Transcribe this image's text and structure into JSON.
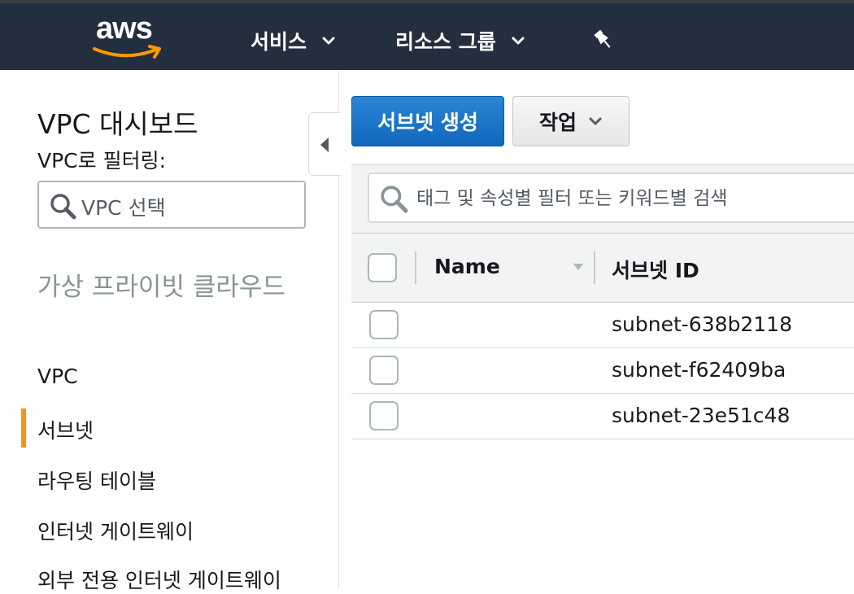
{
  "topbar": {
    "logo_text": "aws",
    "services_label": "서비스",
    "resource_groups_label": "리소스 그룹",
    "colors": {
      "background": "#232f3e",
      "smile": "#ff9900"
    },
    "icons": [
      "chevron-down-icon",
      "pin-icon"
    ]
  },
  "sidebar": {
    "title": "VPC 대시보드",
    "filter_label": "VPC로 필터링:",
    "vpc_select_placeholder": "VPC 선택",
    "section_heading": "가상 프라이빗 클라우드",
    "items": [
      {
        "label": "VPC",
        "active": false
      },
      {
        "label": "서브넷",
        "active": true
      },
      {
        "label": "라우팅 테이블",
        "active": false
      },
      {
        "label": "인터넷 게이트웨이",
        "active": false
      },
      {
        "label": "외부 전용 인터넷 게이트웨이",
        "active": false
      }
    ],
    "active_color": "#f0932b"
  },
  "toolbar": {
    "create_subnet_label": "서브넷 생성",
    "actions_label": "작업"
  },
  "search": {
    "placeholder": "태그 및 속성별 필터 또는 키워드별 검색",
    "value": ""
  },
  "table": {
    "columns": [
      "Name",
      "서브넷 ID"
    ],
    "rows": [
      {
        "name": "",
        "subnet_id": "subnet-638b2118"
      },
      {
        "name": "",
        "subnet_id": "subnet-f62409ba"
      },
      {
        "name": "",
        "subnet_id": "subnet-23e51c48"
      }
    ]
  }
}
